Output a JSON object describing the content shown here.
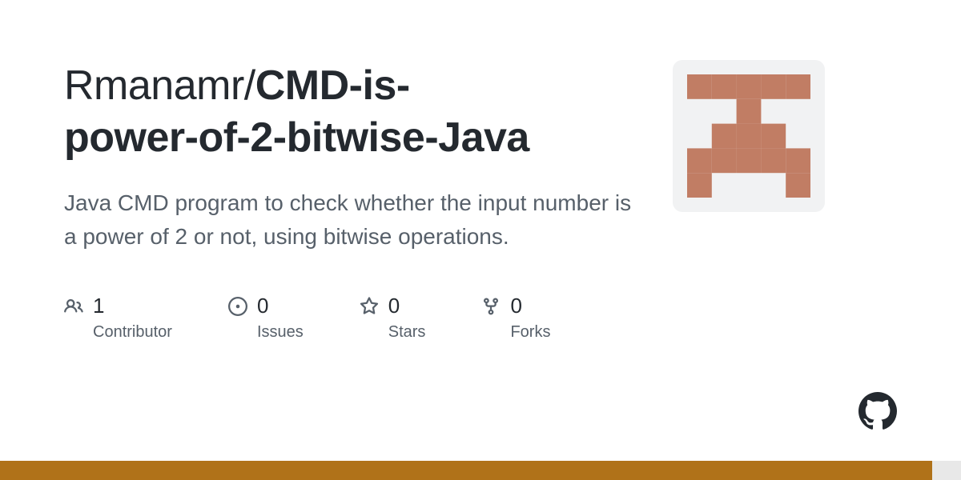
{
  "repo": {
    "owner": "Rmanamr",
    "separator": "/",
    "name_part1": "CMD-is-",
    "name_part2": "power-of-2-bitwise-Java",
    "description": "Java CMD program to check whether the input number is a power of 2 or not, using bitwise operations."
  },
  "stats": {
    "contributors": {
      "count": "1",
      "label": "Contributor"
    },
    "issues": {
      "count": "0",
      "label": "Issues"
    },
    "stars": {
      "count": "0",
      "label": "Stars"
    },
    "forks": {
      "count": "0",
      "label": "Forks"
    }
  },
  "language_bar": {
    "primary_color": "#b07219",
    "primary_width": "97%",
    "secondary_width": "3%"
  }
}
